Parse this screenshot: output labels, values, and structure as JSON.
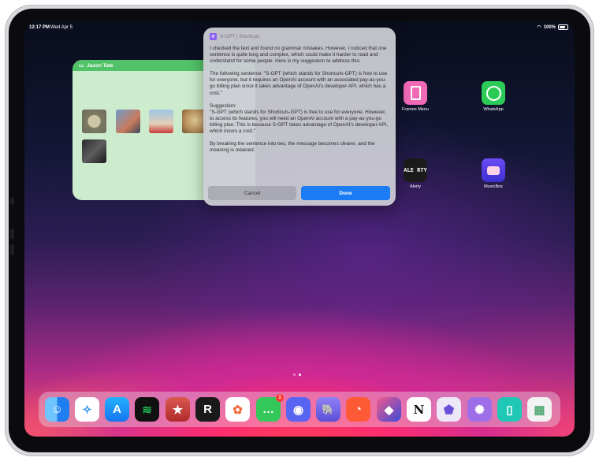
{
  "status_bar": {
    "time": "12:17 PM",
    "date": "Wed Apr 5",
    "battery": "100%"
  },
  "widget": {
    "title": "Jason Tate"
  },
  "home_apps": [
    {
      "label": "Frames Menu",
      "icon": "frames-icon",
      "color": "#f06ab6"
    },
    {
      "label": "WhatsApp",
      "icon": "whatsapp-icon",
      "color": "#2ccb55"
    },
    {
      "label": "Alerty",
      "icon": "alerty-icon",
      "color": "#1b1b1b",
      "glyph": "ALE RTY"
    },
    {
      "label": "MusicBox",
      "icon": "musicbox-icon",
      "color": "#5a3df0"
    }
  ],
  "dialog": {
    "app_name": "S-GPT | Shortcuts",
    "paragraphs": [
      "I checked the text and found no grammar mistakes. However, I noticed that one sentence is quite long and complex, which could make it harder to read and understand for some people. Here is my suggestion to address this:",
      "The following sentence: \"S-GPT (which stands for Shortcuts-GPT) is free to use for everyone, but it requires an OpenAI account with an associated pay-as-you-go billing plan since it takes advantage of OpenAI's developer API, which has a cost.\"",
      "Suggestion:\n\"S-GPT (which stands for Shortcuts-GPT) is free to use for everyone. However, to access its features, you will need an OpenAI account with a pay-as-you-go billing plan. This is because S-GPT takes advantage of OpenAI's developer API, which incurs a cost.\"",
      "By breaking the sentence into two, the message becomes clearer, and the meaning is retained."
    ],
    "cancel_label": "Cancel",
    "done_label": "Done"
  },
  "dock_apps": [
    {
      "name": "finder-icon",
      "color": "#2f8ef5",
      "glyph": "☺"
    },
    {
      "name": "safari-icon",
      "color": "#2c90f2",
      "glyph": "✧"
    },
    {
      "name": "app-store-icon",
      "color": "#1e90ff",
      "glyph": "A"
    },
    {
      "name": "spotify-icon",
      "color": "#1db954",
      "glyph": "≋"
    },
    {
      "name": "cloud-app-icon",
      "color": "#c8423c",
      "glyph": "★"
    },
    {
      "name": "reeder-icon",
      "color": "#1a1a1a",
      "glyph": "R"
    },
    {
      "name": "photos-icon",
      "color": "#ffffff",
      "glyph": "✿"
    },
    {
      "name": "messages-icon",
      "color": "#34c759",
      "glyph": "…",
      "badge": "1"
    },
    {
      "name": "discord-icon",
      "color": "#5865f2",
      "glyph": "◉"
    },
    {
      "name": "mastodon-icon",
      "color": "#7b6cf0",
      "glyph": "🐘"
    },
    {
      "name": "timer-icon",
      "color": "#ff5a36",
      "glyph": "◔"
    },
    {
      "name": "shortcuts-icon",
      "color": "#3b4ad8",
      "glyph": "◆"
    },
    {
      "name": "notion-icon",
      "color": "#ffffff",
      "glyph": "N"
    },
    {
      "name": "obsidian-icon",
      "color": "#e8e4f5",
      "glyph": "⬟"
    },
    {
      "name": "brain-app-icon",
      "color": "#9d6ee8",
      "glyph": "✺"
    },
    {
      "name": "frames-icon",
      "color": "#1fc7b5",
      "glyph": "▯"
    },
    {
      "name": "app-library-icon",
      "color": "#f2f2f2",
      "glyph": "▦"
    }
  ]
}
